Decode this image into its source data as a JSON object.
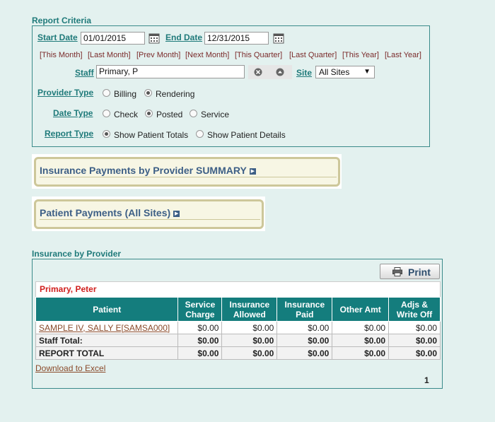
{
  "criteria": {
    "section_title": "Report Criteria",
    "start_date_label": "Start Date",
    "start_date_value": "01/01/2015",
    "end_date_label": "End Date",
    "end_date_value": "12/31/2015",
    "quick_ranges": [
      "[This Month]",
      "[Last Month]",
      "[Prev Month]",
      "[Next Month]",
      "[This Quarter]",
      "[Last Quarter]",
      "[This Year]",
      "[Last Year]"
    ],
    "staff_label": "Staff",
    "staff_value": "Primary, P",
    "site_label": "Site",
    "site_value": "All Sites",
    "provider_type_label": "Provider Type",
    "provider_type_options": [
      "Billing",
      "Rendering"
    ],
    "provider_type_selected": "Rendering",
    "date_type_label": "Date Type",
    "date_type_options": [
      "Check",
      "Posted",
      "Service"
    ],
    "date_type_selected": "Posted",
    "report_type_label": "Report Type",
    "report_type_options": [
      "Show Patient Totals",
      "Show Patient Details"
    ],
    "report_type_selected": "Show Patient Totals"
  },
  "panels": {
    "insurance_summary_title": "Insurance Payments by Provider SUMMARY",
    "patient_payments_title": "Patient Payments (All Sites)"
  },
  "report": {
    "section_title": "Insurance by Provider",
    "print_label": "Print",
    "provider_name": "Primary, Peter",
    "headers": [
      "Patient",
      "Service Charge",
      "Insurance Allowed",
      "Insurance Paid",
      "Other Amt",
      "Adjs & Write Off"
    ],
    "rows": [
      {
        "patient": "SAMPLE IV, SALLY E[SAMSA000]",
        "service_charge": "$0.00",
        "insurance_allowed": "$0.00",
        "insurance_paid": "$0.00",
        "other_amt": "$0.00",
        "adjs_write_off": "$0.00"
      }
    ],
    "staff_total": {
      "label": "Staff Total:",
      "service_charge": "$0.00",
      "insurance_allowed": "$0.00",
      "insurance_paid": "$0.00",
      "other_amt": "$0.00",
      "adjs_write_off": "$0.00"
    },
    "report_total": {
      "label": "REPORT TOTAL",
      "service_charge": "$0.00",
      "insurance_allowed": "$0.00",
      "insurance_paid": "$0.00",
      "other_amt": "$0.00",
      "adjs_write_off": "$0.00"
    },
    "download_label": "Download to Excel",
    "page_number": "1"
  },
  "colors": {
    "accent": "#1f7a7a",
    "header_bg": "#147d7d",
    "provider_name": "#d0201e",
    "panel_title": "#3d5f86"
  }
}
